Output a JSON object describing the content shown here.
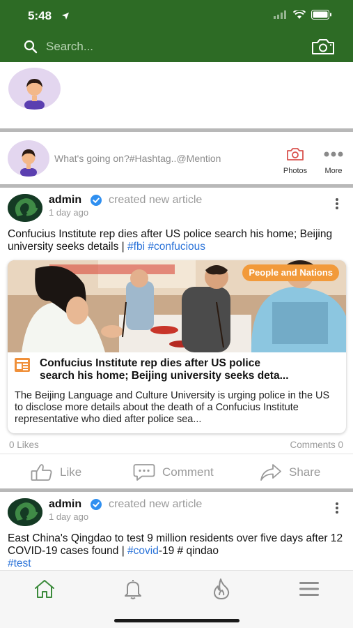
{
  "status_bar": {
    "time": "5:48"
  },
  "search": {
    "placeholder": "Search..."
  },
  "composer": {
    "placeholder": "What's going on?#Hashtag..@Mention",
    "photos_label": "Photos",
    "more_label": "More"
  },
  "posts": [
    {
      "author": "admin",
      "action": "created new article",
      "time": "1 day ago",
      "text": "Confucius Institute rep dies after US police search his home; Beijing university seeks details | ",
      "hashtags": [
        "#fbi",
        "#confucious"
      ],
      "article": {
        "category": "People and Nations",
        "title_line1": "Confucius Institute rep dies after US police",
        "title_line2": "search his home; Beijing university seeks deta...",
        "description": "The Beijing Language and Culture University is urging police in the US to disclose more details about the death of a Confucius Institute representative who died after police sea..."
      },
      "likes": "0 Likes",
      "comments": "Comments 0",
      "actions": {
        "like": "Like",
        "comment": "Comment",
        "share": "Share"
      }
    },
    {
      "author": "admin",
      "action": "created new article",
      "time": "1 day ago",
      "text_part1": "East China's Qingdao to test 9 million residents over five days after 12 COVID-19 cases found | ",
      "hashtag_covid": "#covid",
      "text_part2": "-19 # qindao",
      "hashtag_test": "#test"
    }
  ],
  "colors": {
    "header_green": "#2d6b25",
    "hashtag_blue": "#2a72d8",
    "badge_orange": "#f29a3a",
    "home_active": "#3a8a3a"
  },
  "icons": [
    "search-icon",
    "camera-icon",
    "photos-icon",
    "more-icon",
    "verified-icon",
    "kebab-menu-icon",
    "article-icon",
    "like-icon",
    "comment-icon",
    "share-icon",
    "home-icon",
    "bell-icon",
    "flame-icon",
    "hamburger-menu-icon"
  ]
}
